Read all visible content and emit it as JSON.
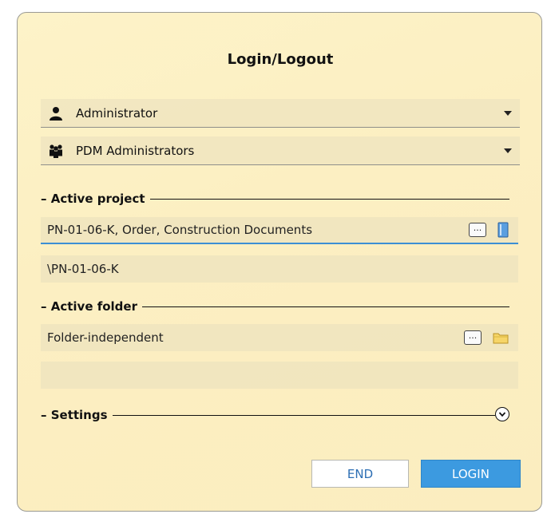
{
  "dialog": {
    "title": "Login/Logout"
  },
  "user_select": {
    "value": "Administrator",
    "icon": "user-icon"
  },
  "group_select": {
    "value": "PDM Administrators",
    "icon": "user-group-icon"
  },
  "active_project": {
    "header": "– Active project",
    "name": "PN-01-06-K, Order, Construction Documents",
    "path": "\\PN-01-06-K",
    "browse_label": "...",
    "trail_icon": "project-book-icon"
  },
  "active_folder": {
    "header": "– Active folder",
    "name": "Folder-independent",
    "path": "",
    "browse_label": "...",
    "trail_icon": "folder-icon"
  },
  "settings": {
    "header": "– Settings",
    "expand_icon": "chevron-down-circle-icon"
  },
  "buttons": {
    "end": "END",
    "login": "LOGIN"
  },
  "colors": {
    "background": "#fcefc2",
    "accent": "#3c9ae0",
    "focus_underline": "#3c8fd4"
  }
}
